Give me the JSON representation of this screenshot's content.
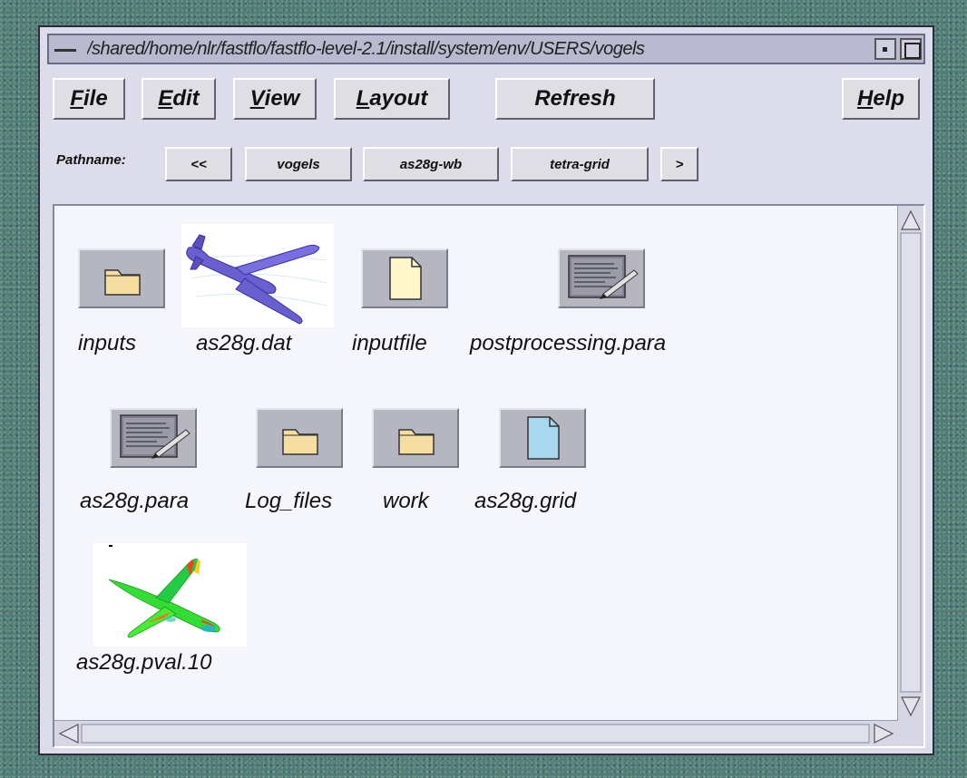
{
  "window": {
    "title": "/shared/home/nlr/fastflo/fastflo-level-2.1/install/system/env/USERS/vogels"
  },
  "menu": {
    "file": "File",
    "edit": "Edit",
    "view": "View",
    "layout": "Layout",
    "refresh": "Refresh",
    "help": "Help"
  },
  "pathbar": {
    "label": "Pathname:",
    "back": "<<",
    "segments": [
      "vogels",
      "as28g-wb",
      "tetra-grid"
    ],
    "forward": ">"
  },
  "files": [
    {
      "name": "inputs",
      "icon": "folder-icon"
    },
    {
      "name": "as28g.dat",
      "icon": "aircraft-mesh-thumbnail"
    },
    {
      "name": "inputfile",
      "icon": "document-icon"
    },
    {
      "name": "postprocessing.para",
      "icon": "parameter-file-icon"
    },
    {
      "name": "as28g.para",
      "icon": "parameter-file-icon"
    },
    {
      "name": "Log_files",
      "icon": "folder-icon"
    },
    {
      "name": "work",
      "icon": "folder-icon"
    },
    {
      "name": "as28g.grid",
      "icon": "grid-document-icon"
    },
    {
      "name": "as28g.pval.10",
      "icon": "aircraft-pressure-thumbnail"
    }
  ]
}
